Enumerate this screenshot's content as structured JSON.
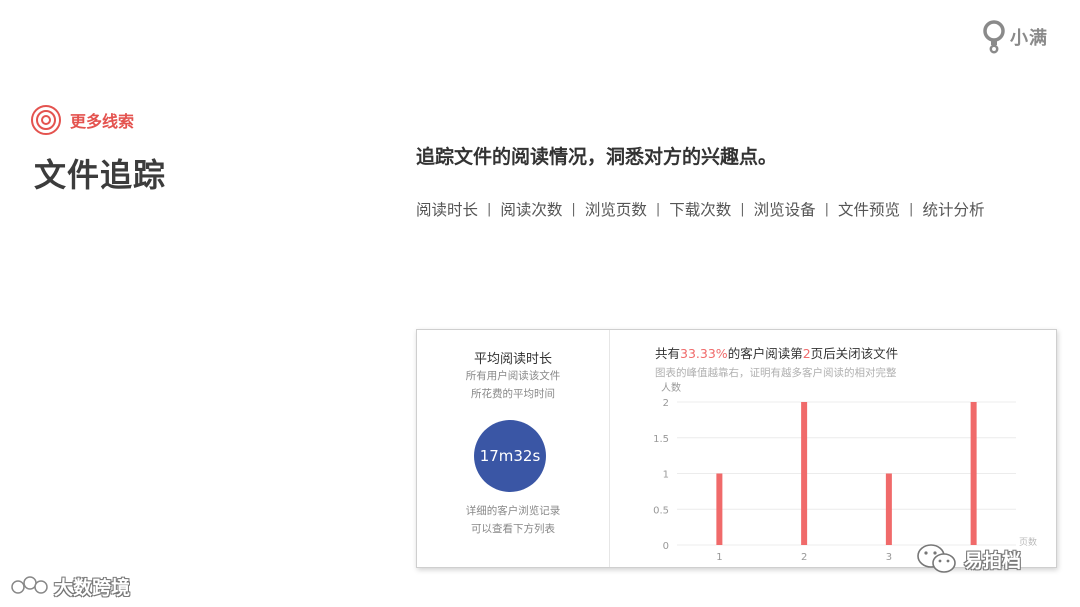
{
  "brand": {
    "name": "小满"
  },
  "tag": {
    "label": "更多线索"
  },
  "title": "文件追踪",
  "subtitle": "追踪文件的阅读情况，洞悉对方的兴趣点。",
  "features": [
    "阅读时长",
    "阅读次数",
    "浏览页数",
    "下载次数",
    "浏览设备",
    "文件预览",
    "统计分析"
  ],
  "panel": {
    "left": {
      "title": "平均阅读时长",
      "desc_line1": "所有用户阅读该文件",
      "desc_line2": "所花费的平均时间",
      "value": "17m32s",
      "foot_line1": "详细的客户浏览记录",
      "foot_line2": "可以查看下方列表"
    },
    "chart_head": {
      "prefix": "共有",
      "pct": "33.33%",
      "middle": "的客户阅读第",
      "page": "2",
      "suffix": "页后关闭该文件"
    },
    "chart_note": "图表的峰值越靠右，证明有越多客户阅读的相对完整"
  },
  "chart_data": {
    "type": "bar",
    "ylabel": "人数",
    "xlabel": "页数",
    "categories": [
      "1",
      "2",
      "3",
      "4"
    ],
    "values": [
      1,
      2,
      1,
      2
    ],
    "ylim": [
      0,
      2
    ],
    "yticks": [
      "0",
      "0.5",
      "1",
      "1.5",
      "2"
    ],
    "bar_color": "#f06a6a",
    "grid": true
  },
  "watermarks": {
    "left": "大数跨境",
    "right": "易拍档"
  },
  "colors": {
    "accent": "#e4534f",
    "circle": "#3a56a5",
    "bar": "#f06a6a"
  }
}
